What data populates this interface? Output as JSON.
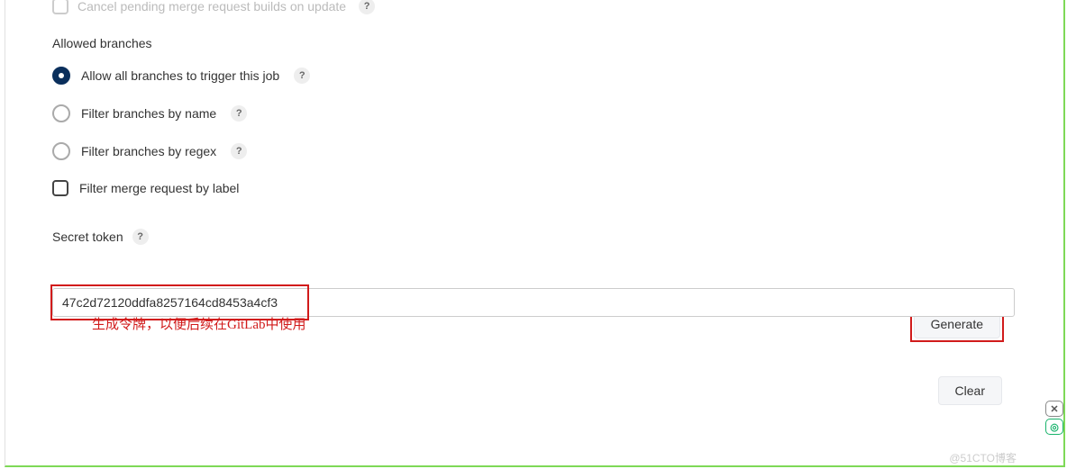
{
  "cancel_pending": {
    "label": "Cancel pending merge request builds on update"
  },
  "allowed_branches": {
    "heading": "Allowed branches",
    "options": {
      "allow_all": "Allow all branches to trigger this job",
      "by_name": "Filter branches by name",
      "by_regex": "Filter branches by regex",
      "by_label": "Filter merge request by label"
    },
    "selected": "allow_all"
  },
  "secret_token": {
    "label": "Secret token",
    "value": "47c2d72120ddfa8257164cd8453a4cf3",
    "generate_button": "Generate",
    "clear_button": "Clear",
    "annotation": "生成令牌，以便后续在GitLab中使用"
  },
  "watermark": "@51CTO博客",
  "side_close": "✕",
  "side_icon": "◎"
}
